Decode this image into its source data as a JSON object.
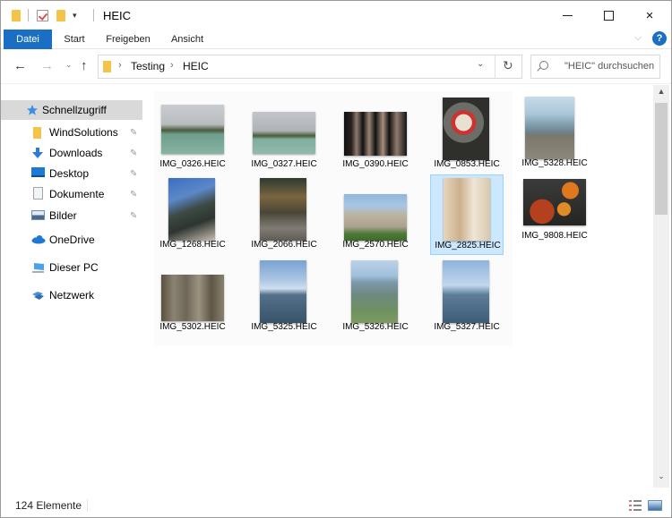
{
  "window": {
    "title": "HEIC",
    "controls": {
      "minimize": "minimize",
      "maximize": "maximize",
      "close": "×"
    }
  },
  "ribbon": {
    "tabs": [
      "Datei",
      "Start",
      "Freigeben",
      "Ansicht"
    ],
    "active_tab": "Datei",
    "expand_icon": "⌵",
    "help_label": "?"
  },
  "navigation": {
    "back": "←",
    "forward": "→",
    "recent": "⌄",
    "up": "↑",
    "breadcrumb": [
      "Testing",
      "HEIC"
    ],
    "crumb_separator": "›",
    "dropdown": "⌄",
    "refresh": "↻",
    "search_placeholder": "\"HEIC\" durchsuchen"
  },
  "sidebar": {
    "items": [
      {
        "label": "Schnellzugriff",
        "icon": "star-icon",
        "active": true,
        "pinned": false
      },
      {
        "label": "WindSolutions",
        "icon": "folder-icon",
        "active": false,
        "pinned": true
      },
      {
        "label": "Downloads",
        "icon": "download-icon",
        "active": false,
        "pinned": true
      },
      {
        "label": "Desktop",
        "icon": "desktop-icon",
        "active": false,
        "pinned": true
      },
      {
        "label": "Dokumente",
        "icon": "documents-icon",
        "active": false,
        "pinned": true
      },
      {
        "label": "Bilder",
        "icon": "pictures-icon",
        "active": false,
        "pinned": true
      },
      {
        "label": "OneDrive",
        "icon": "cloud-icon",
        "active": false,
        "pinned": false
      },
      {
        "label": "Dieser PC",
        "icon": "computer-icon",
        "active": false,
        "pinned": false
      },
      {
        "label": "Netzwerk",
        "icon": "network-icon",
        "active": false,
        "pinned": false
      }
    ],
    "pin_glyph": "📌"
  },
  "files": [
    {
      "name": "IMG_0326.HEIC",
      "selected": false
    },
    {
      "name": "IMG_0327.HEIC",
      "selected": false
    },
    {
      "name": "IMG_0390.HEIC",
      "selected": false
    },
    {
      "name": "IMG_0853.HEIC",
      "selected": false
    },
    {
      "name": "IMG_5328.HEIC",
      "selected": false
    },
    {
      "name": "IMG_1268.HEIC",
      "selected": false
    },
    {
      "name": "IMG_2066.HEIC",
      "selected": false
    },
    {
      "name": "IMG_2570.HEIC",
      "selected": false
    },
    {
      "name": "IMG_2825.HEIC",
      "selected": true
    },
    {
      "name": "IMG_9808.HEIC",
      "selected": false
    },
    {
      "name": "IMG_5302.HEIC",
      "selected": false
    },
    {
      "name": "IMG_5325.HEIC",
      "selected": false
    },
    {
      "name": "IMG_5326.HEIC",
      "selected": false
    },
    {
      "name": "IMG_5327.HEIC",
      "selected": false
    }
  ],
  "scrollbar": {
    "up": "▲",
    "down": "⌄"
  },
  "status": {
    "item_count": "124 Elemente"
  },
  "colors": {
    "accent": "#1a6fc4",
    "selection_bg": "#cce8ff",
    "selection_border": "#99d1ff",
    "folder": "#f3c447"
  }
}
